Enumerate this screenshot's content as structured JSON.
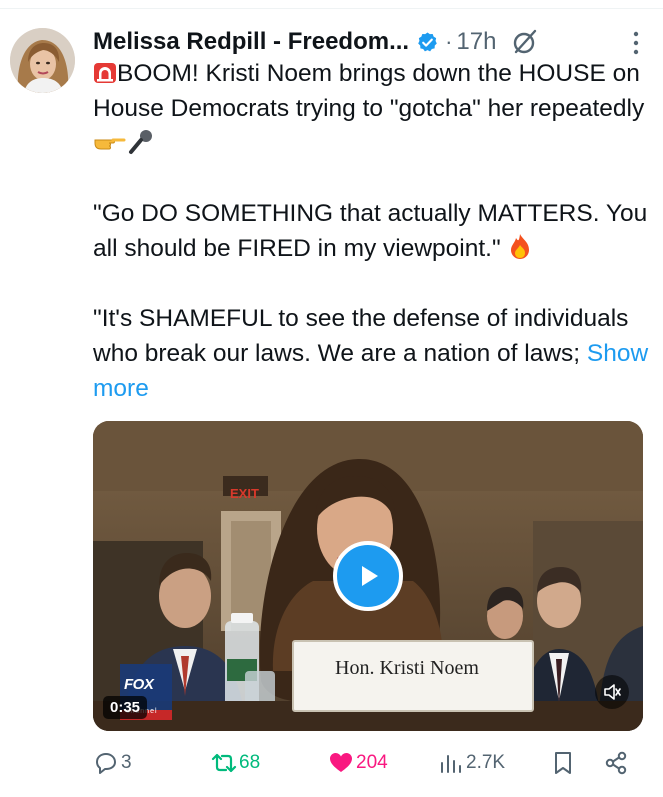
{
  "post": {
    "author_name": "Melissa Redpill - Freedom...",
    "separator": "·",
    "time": "17h",
    "text_line1": "BOOM! Kristi Noem brings down the HOUSE on House Democrats trying to \"gotcha\" her repeatedly",
    "text_quote1": "\"Go DO SOMETHING that actually MATTERS. You all should be FIRED in my viewpoint.\"",
    "text_quote2": "\"It's SHAMEFUL to see the defense of individuals who break our laws. We are a nation of laws;",
    "show_more": "Show more"
  },
  "media": {
    "duration": "0:35",
    "nameplate": "Hon. Kristi Noem",
    "network_logo_text": "FOX",
    "network_logo_sub": "channel",
    "exit_sign": "EXIT"
  },
  "actions": {
    "replies": "3",
    "reposts": "68",
    "likes": "204",
    "views": "2.7K"
  },
  "icons": {
    "verified": "verified-badge-icon",
    "grok": "grok-icon",
    "more": "more-options-icon",
    "reply": "reply-icon",
    "repost": "repost-icon",
    "like": "heart-icon",
    "views": "views-icon",
    "bookmark": "bookmark-icon",
    "share": "share-icon",
    "play": "play-icon",
    "mute": "mute-icon",
    "siren_emoji": "siren-emoji",
    "hand_emoji": "pointing-hand-emoji",
    "mic_emoji": "microphone-emoji",
    "fire_emoji": "fire-emoji"
  },
  "colors": {
    "link": "#1d9bf0",
    "verified": "#1d9bf0",
    "repost_active": "#00ba7c",
    "like_active": "#f91880",
    "secondary_text": "#536471"
  }
}
